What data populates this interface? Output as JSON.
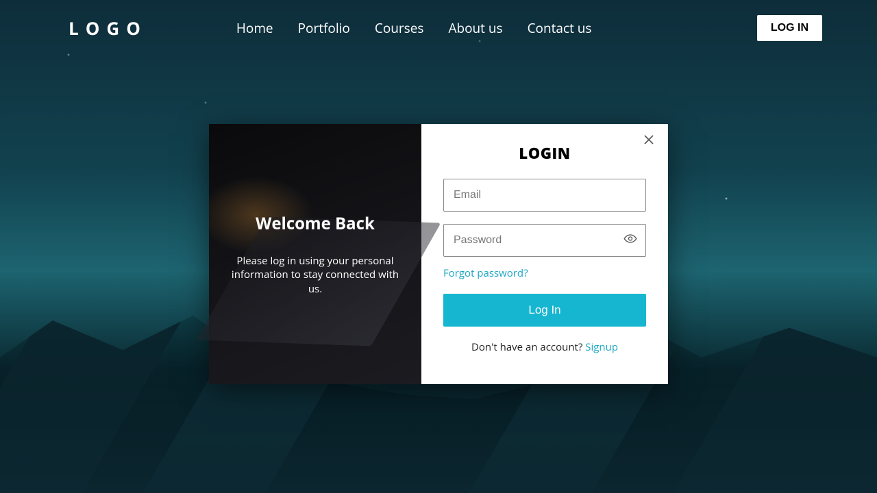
{
  "header": {
    "logo": "LOGO",
    "nav": [
      "Home",
      "Portfolio",
      "Courses",
      "About us",
      "Contact us"
    ],
    "login_button": "LOG IN"
  },
  "modal": {
    "left": {
      "title": "Welcome Back",
      "subtitle": "Please log in using your personal information to stay connected with us."
    },
    "right": {
      "title": "LOGIN",
      "email_placeholder": "Email",
      "password_placeholder": "Password",
      "forgot": "Forgot password?",
      "submit": "Log In",
      "signup_prompt": "Don't have an account? ",
      "signup_link": "Signup"
    }
  },
  "colors": {
    "accent": "#16b6d1",
    "link": "#1aa7c4"
  }
}
